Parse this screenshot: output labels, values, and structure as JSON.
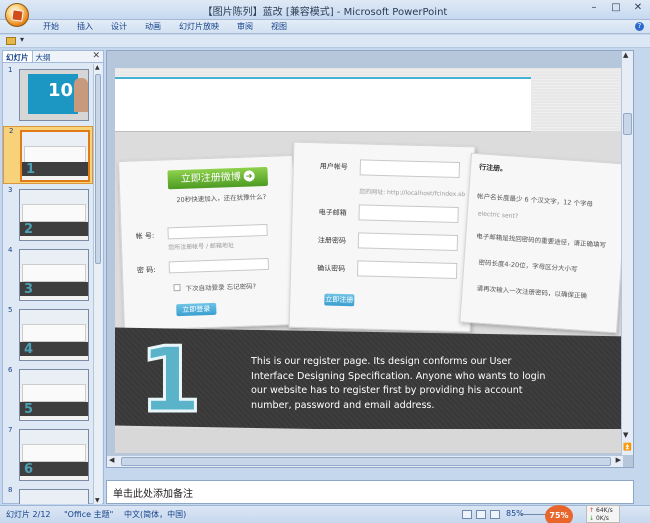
{
  "window": {
    "title": "【图片陈列】蓝改 [兼容模式] - Microsoft PowerPoint",
    "controls": [
      "–",
      "□",
      "✕"
    ]
  },
  "ribbon": {
    "tabs": [
      "开始",
      "插入",
      "设计",
      "动画",
      "幻灯片放映",
      "审阅",
      "视图"
    ],
    "help": "?"
  },
  "qat": {
    "arrow": "▾"
  },
  "left_panel": {
    "tabs": [
      "幻灯片",
      "大纲"
    ],
    "close": "✕",
    "thumbnails": [
      {
        "num": "1",
        "big": "10"
      },
      {
        "num": "2",
        "big": "1",
        "selected": true
      },
      {
        "num": "3",
        "big": "2"
      },
      {
        "num": "4",
        "big": "3"
      },
      {
        "num": "5",
        "big": "4"
      },
      {
        "num": "6",
        "big": "5"
      },
      {
        "num": "7",
        "big": "6"
      },
      {
        "num": "8",
        "big": ""
      }
    ]
  },
  "slide": {
    "card1": {
      "button": "立即注册微博",
      "sub": "20秒快速加入，还在犹豫什么?",
      "account_label": "帐  号:",
      "account_hint": "您所注册帐号 / 邮箱地址",
      "password_label": "密  码:",
      "remember": "下次自动登录  忘记密码?",
      "login_btn": "立即登录"
    },
    "card2": {
      "username": "用户帐号",
      "domain_hint": "您的网址: http://localhost/fcindex.sb",
      "email": "电子邮箱",
      "reg_password": "注册密码",
      "confirm_password": "确认密码",
      "register_btn": "立即注册"
    },
    "card3": {
      "title": "行注册。",
      "line1": "帐户名长度最少 6 个汉文字，12 个字母",
      "line2": "electric sent?",
      "line3": "电子邮箱是找回密码的重要途径，请正确填写",
      "line4": "密码长度4-20位，字母区分大小写",
      "line5": "请再次输入一次注册密码，以确保正确"
    },
    "band_number": "1",
    "description": "This is our register page. Its design conforms our User Interface Designing Specification. Anyone who wants to login our website has to register first by providing his account number, password and email address."
  },
  "notes": {
    "placeholder": "单击此处添加备注"
  },
  "status": {
    "slide_pos": "幻灯片 2/12",
    "theme": "\"Office 主题\"",
    "language": "中文(简体，中国)",
    "zoom": "85%",
    "zoom_badge": "75%",
    "net_up": "64K/s",
    "net_down": "0K/s"
  }
}
